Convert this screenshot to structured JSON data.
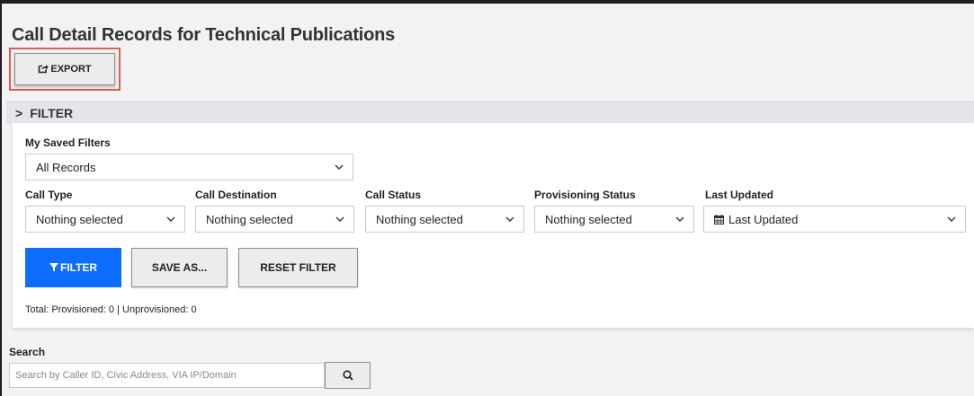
{
  "page": {
    "title": "Call Detail Records for Technical Publications"
  },
  "toolbar": {
    "export_label": "EXPORT",
    "export_icon": "share-square-icon"
  },
  "filter_section": {
    "title": "FILTER",
    "toggle_icon": "chevron-right-icon"
  },
  "saved_filters": {
    "label": "My Saved Filters",
    "value": "All Records"
  },
  "filters": [
    {
      "label": "Call Type",
      "value": "Nothing selected"
    },
    {
      "label": "Call Destination",
      "value": "Nothing selected"
    },
    {
      "label": "Call Status",
      "value": "Nothing selected"
    },
    {
      "label": "Provisioning Status",
      "value": "Nothing selected"
    },
    {
      "label": "Last Updated",
      "value": "Last Updated",
      "icon": "calendar-icon"
    }
  ],
  "buttons": {
    "filter": "FILTER",
    "save_as": "SAVE AS...",
    "reset": "RESET FILTER"
  },
  "totals": "Total: Provisioned: 0 | Unprovisioned: 0",
  "search": {
    "label": "Search",
    "placeholder": "Search by Caller ID, Civic Address, VIA IP/Domain",
    "value": ""
  },
  "colors": {
    "primary": "#0d6efd",
    "highlight": "#e05a52",
    "filter_bar": "#e4e5ea"
  }
}
